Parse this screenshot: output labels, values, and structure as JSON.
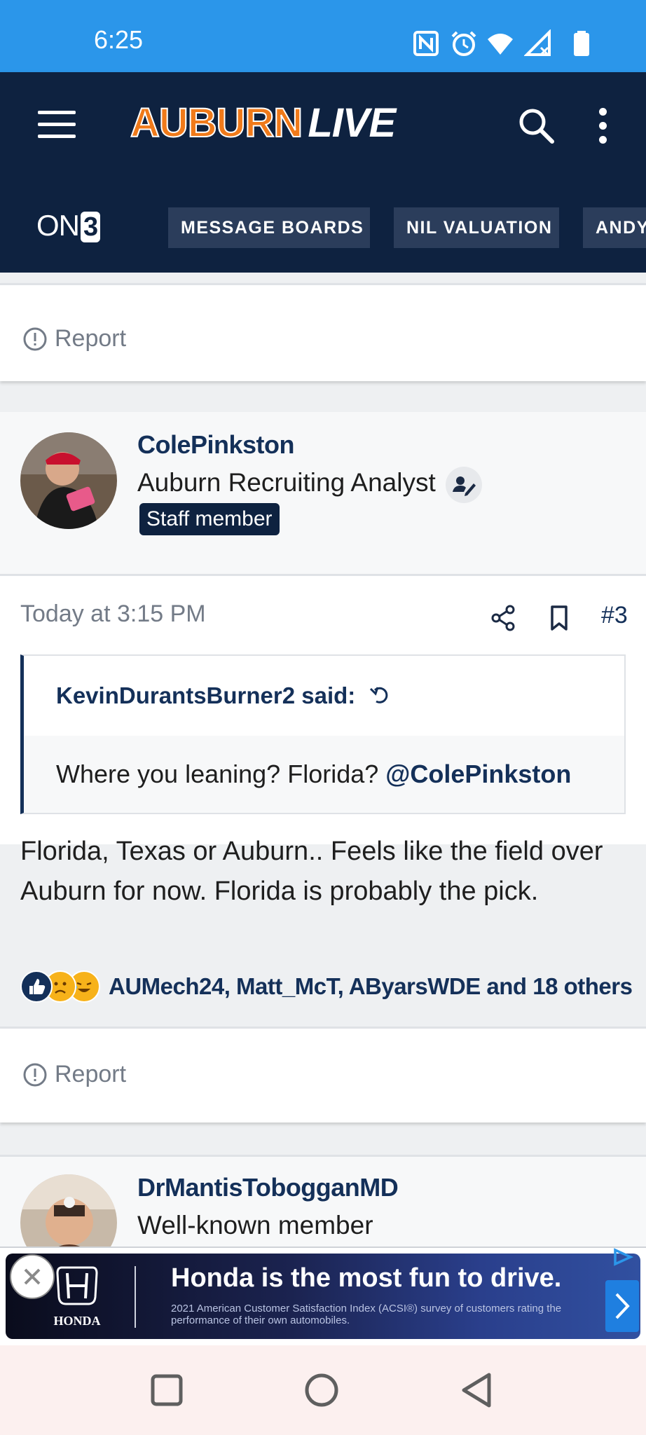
{
  "status_bar": {
    "time": "6:25",
    "icons": [
      "nfc-icon",
      "alarm-icon",
      "wifi-icon",
      "signal-icon",
      "battery-icon"
    ]
  },
  "header": {
    "logo_part1": "AUBURN",
    "logo_part2": "LIVE",
    "on3_label": "ON",
    "on3_digit": "3",
    "nav_items": [
      "MESSAGE BOARDS",
      "NIL VALUATION",
      "ANDY"
    ]
  },
  "report_label": "Report",
  "post": {
    "author": "ColePinkston",
    "title": "Auburn Recruiting Analyst",
    "badge": "Staff member",
    "time": "Today at 3:15 PM",
    "number": "#3",
    "quote": {
      "author": "KevinDurantsBurner2 said:",
      "text": "Where you leaning? Florida?",
      "mention": "@ColePinkston"
    },
    "body": "Florida, Texas or Auburn.. Feels like the field over Auburn for now. Florida is probably the pick.",
    "reactions_text": "AUMech24, Matt_McT, AByarsWDE and 18 others"
  },
  "next_post": {
    "author": "DrMantisTobogganMD",
    "title": "Well-known member"
  },
  "ad": {
    "brand": "HONDA",
    "headline": "Honda is the most fun to drive.",
    "subtext": "2021 American Customer Satisfaction Index (ACSI®) survey of customers rating the performance of their own automobiles."
  },
  "colors": {
    "status_bar": "#2b96ea",
    "header": "#0e2240",
    "auburn_orange": "#f07a1a",
    "link_navy": "#143059"
  }
}
